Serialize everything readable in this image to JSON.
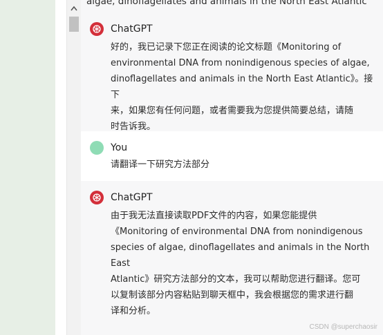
{
  "top_fragment": "algae, dinoflagellates and animals in the North East Atlantic",
  "messages": [
    {
      "author": "ChatGPT",
      "text": "好的，我已记录下您正在阅读的论文标题《Monitoring of\nenvironmental DNA from nonindigenous species of algae,\ndinoflagellates and animals in the North East Atlantic》。接下\n来，如果您有任何问题，或者需要我为您提供简要总结，请随\n时告诉我。"
    },
    {
      "author": "You",
      "text": "请翻译一下研究方法部分"
    },
    {
      "author": "ChatGPT",
      "text": "由于我无法直接读取PDF文件的内容，如果您能提供\n《Monitoring of environmental DNA from nonindigenous\nspecies of algae, dinoflagellates and animals in the North East\nAtlantic》研究方法部分的文本，我可以帮助您进行翻译。您可\n以复制该部分内容粘贴到聊天框中，我会根据您的需求进行翻\n译和分析。"
    }
  ],
  "watermark": "CSDN @superchaosir",
  "colors": {
    "gpt_avatar": "#d32f3a",
    "user_avatar": "#8fdcb5",
    "left_panel": "#e7efe6"
  }
}
